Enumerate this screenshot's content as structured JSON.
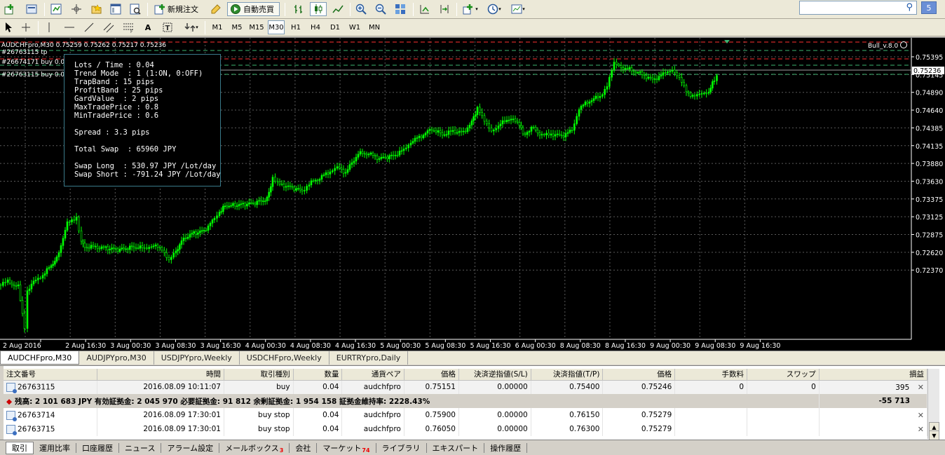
{
  "toolbar": {
    "new_order_label": "新規注文",
    "auto_trade_label": "自動売買",
    "badge_count": "5",
    "timeframes": [
      "M1",
      "M5",
      "M15",
      "M30",
      "H1",
      "H4",
      "D1",
      "W1",
      "MN"
    ],
    "active_timeframe": "M30"
  },
  "chart": {
    "header_line": "AUDCHFpro,M30  0.75259 0.75262 0.75217 0.75236",
    "order_labels": [
      "#26763115 tp",
      "#26674171 buy 0.04",
      "#26763115 buy 0.04"
    ],
    "ea_name": "Bull_v.8.0",
    "price_current": "0.75236",
    "price_ticks": [
      "0.75395",
      "0.75145",
      "0.74890",
      "0.74640",
      "0.74385",
      "0.74135",
      "0.73880",
      "0.73630",
      "0.73375",
      "0.73125",
      "0.72875",
      "0.72620",
      "0.72370"
    ],
    "time_ticks": [
      "2 Aug 2016",
      "2 Aug 16:30",
      "3 Aug 00:30",
      "3 Aug 08:30",
      "3 Aug 16:30",
      "4 Aug 00:30",
      "4 Aug 08:30",
      "4 Aug 16:30",
      "5 Aug 00:30",
      "5 Aug 08:30",
      "5 Aug 16:30",
      "6 Aug 00:30",
      "8 Aug 08:30",
      "8 Aug 16:30",
      "9 Aug 00:30",
      "9 Aug 08:30",
      "9 Aug 16:30"
    ],
    "colors": {
      "bull": "#00ff00",
      "bear": "#00ff00",
      "grid": "#5a5a5a",
      "red_line": "#ff3030",
      "green_line": "#3cb371",
      "bid_line": "#a0a0a0"
    }
  },
  "info_panel": {
    "lines": [
      "Lots / Time : 0.04",
      "Trend Mode  : 1 (1:ON, 0:OFF)",
      "TrapBand : 15 pips",
      "ProfitBand : 25 pips",
      "GardValue  : 2 pips",
      "MaxTradePrice : 0.8",
      "MinTradePrice : 0.6",
      "",
      "Spread : 3.3 pips",
      "",
      "Total Swap  : 65960 JPY",
      "",
      "Swap Long  : 530.97 JPY /Lot/day",
      "Swap Short : -791.24 JPY /Lot/day"
    ]
  },
  "symbol_tabs": [
    "AUDCHFpro,M30",
    "AUDJPYpro,M30",
    "USDJPYpro,Weekly",
    "USDCHFpro,Weekly",
    "EURTRYpro,Daily"
  ],
  "terminal": {
    "headers": [
      "注文番号",
      "時間",
      "取引種別",
      "数量",
      "通貨ペア",
      "価格",
      "決済逆指値(S/L)",
      "決済指値(T/P)",
      "価格",
      "手数料",
      "スワップ",
      "損益"
    ],
    "positions": [
      {
        "ticket": "26763115",
        "time": "2016.08.09 10:11:07",
        "type": "buy",
        "lots": "0.04",
        "symbol": "audchfpro",
        "open": "0.75151",
        "sl": "0.00000",
        "tp": "0.75400",
        "price": "0.75246",
        "commission": "0",
        "swap": "0",
        "profit": "395"
      }
    ],
    "balance_text": "残高: 2 101 683 JPY  有効証拠金: 2 045 970  必要証拠金: 91 812  余剰証拠金: 1 954 158  証拠金維持率: 2228.43%",
    "balance_profit": "-55 713",
    "pending": [
      {
        "ticket": "26763714",
        "time": "2016.08.09 17:30:01",
        "type": "buy stop",
        "lots": "0.04",
        "symbol": "audchfpro",
        "open": "0.75900",
        "sl": "0.00000",
        "tp": "0.76150",
        "price": "0.75279"
      },
      {
        "ticket": "26763715",
        "time": "2016.08.09 17:30:01",
        "type": "buy stop",
        "lots": "0.04",
        "symbol": "audchfpro",
        "open": "0.76050",
        "sl": "0.00000",
        "tp": "0.76300",
        "price": "0.75279"
      }
    ]
  },
  "bottom_tabs": [
    {
      "label": "取引",
      "count": ""
    },
    {
      "label": "運用比率",
      "count": ""
    },
    {
      "label": "口座履歴",
      "count": ""
    },
    {
      "label": "ニュース",
      "count": ""
    },
    {
      "label": "アラーム設定",
      "count": ""
    },
    {
      "label": "メールボックス",
      "count": "3"
    },
    {
      "label": "会社",
      "count": ""
    },
    {
      "label": "マーケット",
      "count": "74"
    },
    {
      "label": "ライブラリ",
      "count": ""
    },
    {
      "label": "エキスパート",
      "count": ""
    },
    {
      "label": "操作履歴",
      "count": ""
    }
  ]
}
